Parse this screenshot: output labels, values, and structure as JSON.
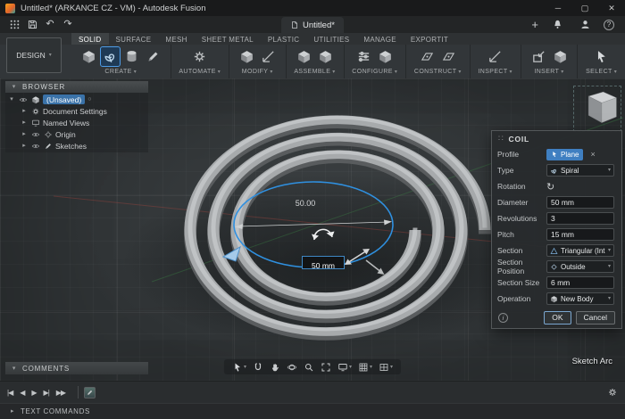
{
  "window": {
    "title": "Untitled* (ARKANCE CZ - VM) - Autodesk Fusion",
    "minimize": "─",
    "maximize": "▢",
    "close": "✕"
  },
  "quickbar": {
    "doc_tab": "Untitled*"
  },
  "tabs": [
    "SOLID",
    "SURFACE",
    "MESH",
    "SHEET METAL",
    "PLASTIC",
    "UTILITIES",
    "MANAGE",
    "EXPORTIT"
  ],
  "ribbon": {
    "design": "DESIGN",
    "groups": [
      "CREATE",
      "AUTOMATE",
      "MODIFY",
      "ASSEMBLE",
      "CONFIGURE",
      "CONSTRUCT",
      "INSPECT",
      "INSERT",
      "SELECT"
    ]
  },
  "browser": {
    "title": "BROWSER",
    "root": "(Unsaved)",
    "items": [
      "Document Settings",
      "Named Views",
      "Origin",
      "Sketches"
    ]
  },
  "viewport": {
    "dimension": "50.00",
    "dim_value": "50 mm",
    "status_hint": "Sketch Arc"
  },
  "coil": {
    "title": "COIL",
    "rows": [
      {
        "label": "Profile",
        "value": "Plane"
      },
      {
        "label": "Type",
        "value": "Spiral"
      },
      {
        "label": "Rotation",
        "value": ""
      },
      {
        "label": "Diameter",
        "value": "50 mm"
      },
      {
        "label": "Revolutions",
        "value": "3"
      },
      {
        "label": "Pitch",
        "value": "15 mm"
      },
      {
        "label": "Section",
        "value": "Triangular (Int..."
      },
      {
        "label": "Section Position",
        "value": "Outside"
      },
      {
        "label": "Section Size",
        "value": "6 mm"
      },
      {
        "label": "Operation",
        "value": "New Body"
      }
    ],
    "ok": "OK",
    "cancel": "Cancel"
  },
  "panels": {
    "comments": "COMMENTS",
    "text_commands": "TEXT COMMANDS"
  },
  "colors": {
    "accent": "#3f88c5",
    "selection": "#3a72a8",
    "sketch": "#2f90e0"
  },
  "icons": {
    "caret": "▾",
    "chevron_right": "▸",
    "chevron_down": "▾",
    "undo": "↶",
    "redo": "↷",
    "plus": "+",
    "help": "?",
    "rotation": "↻",
    "close_chip": "×",
    "info": "i",
    "grip": "∷",
    "marker": "○",
    "play_first": "|◀",
    "play_prev": "◀",
    "play": "▶",
    "play_next": "▶|",
    "play_last": "▶▶"
  }
}
